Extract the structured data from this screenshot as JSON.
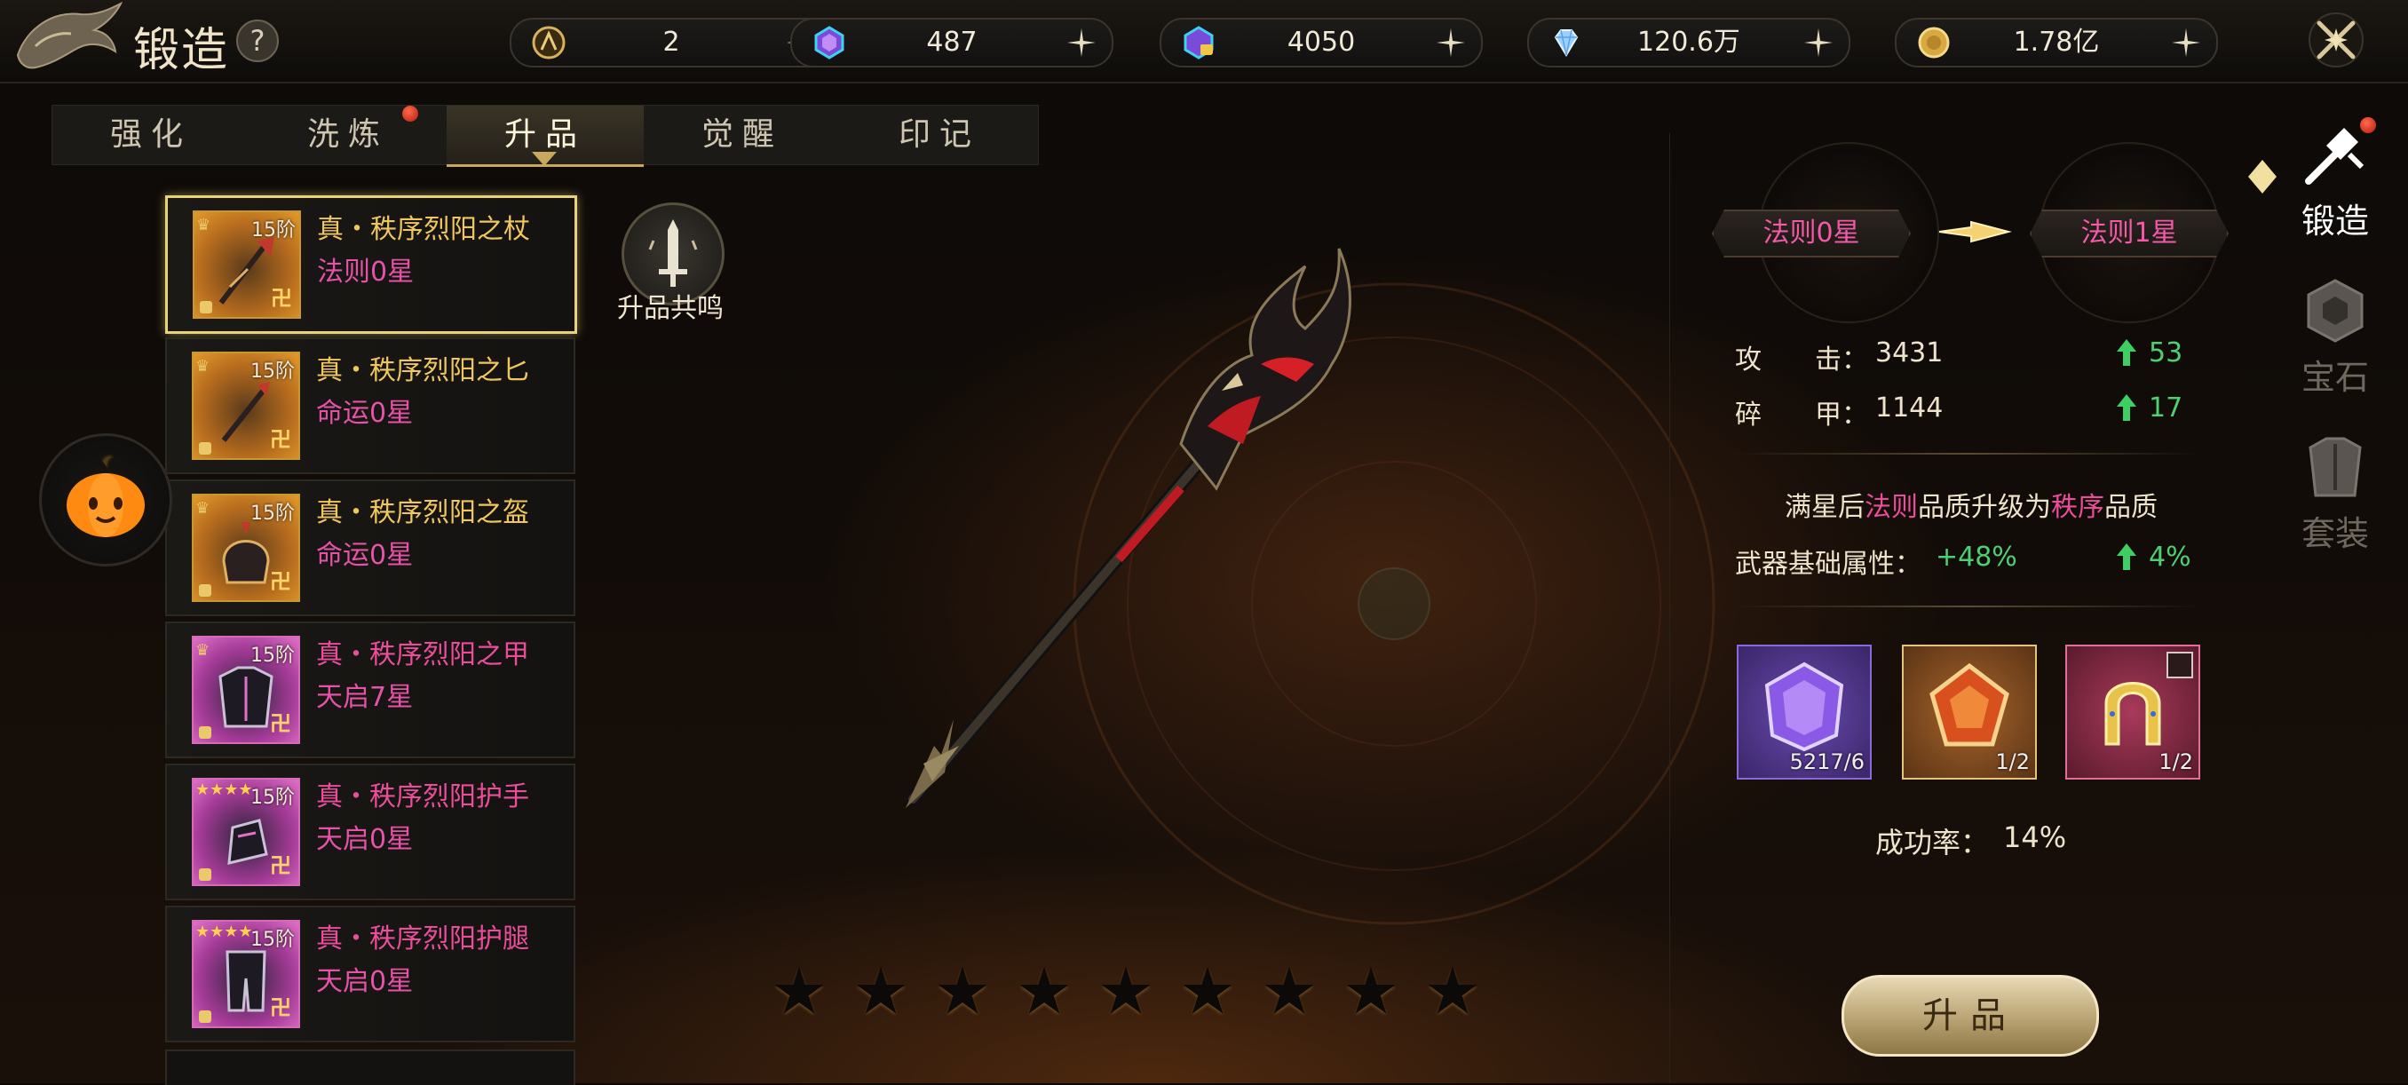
{
  "header": {
    "title": "锻造",
    "help_label": "?"
  },
  "resources": [
    {
      "icon": "compass-coin-icon",
      "value": "2"
    },
    {
      "icon": "purple-crystal-icon",
      "value": "487"
    },
    {
      "icon": "purple-crystal-lock-icon",
      "value": "4050"
    },
    {
      "icon": "diamond-icon",
      "value": "120.6万"
    },
    {
      "icon": "gold-coin-icon",
      "value": "1.78亿"
    }
  ],
  "tabs": [
    {
      "label": "强化",
      "active": false,
      "badge": false
    },
    {
      "label": "洗炼",
      "active": false,
      "badge": true
    },
    {
      "label": "升品",
      "active": true,
      "badge": false
    },
    {
      "label": "觉醒",
      "active": false,
      "badge": false
    },
    {
      "label": "印记",
      "active": false,
      "badge": false
    }
  ],
  "equipment": [
    {
      "name": "真・秩序烈阳之杖",
      "grade": "法则0星",
      "level": "15阶",
      "theme": "orange",
      "selected": true
    },
    {
      "name": "真・秩序烈阳之匕",
      "grade": "命运0星",
      "level": "15阶",
      "theme": "orange",
      "selected": false
    },
    {
      "name": "真・秩序烈阳之盔",
      "grade": "命运0星",
      "level": "15阶",
      "theme": "orange",
      "selected": false
    },
    {
      "name": "真・秩序烈阳之甲",
      "grade": "天启7星",
      "level": "15阶",
      "theme": "pink",
      "selected": false
    },
    {
      "name": "真・秩序烈阳护手",
      "grade": "天启0星",
      "level": "15阶",
      "theme": "pink",
      "selected": false
    },
    {
      "name": "真・秩序烈阳护腿",
      "grade": "天启0星",
      "level": "15阶",
      "theme": "pink",
      "selected": false
    }
  ],
  "resonance": {
    "label": "升品共鸣"
  },
  "stars": {
    "filled": 0,
    "total": 9
  },
  "upgrade": {
    "from_grade": "法则0星",
    "to_grade": "法则1星",
    "stats": [
      {
        "label": "攻　　击：",
        "value": "3431",
        "gain": "53"
      },
      {
        "label": "碎　　甲：",
        "value": "1144",
        "gain": "17"
      }
    ],
    "note_prefix": "满星后",
    "note_from": "法则",
    "note_mid": "品质升级为",
    "note_to": "秩序",
    "note_suffix": "品质",
    "base_attr_label": "武器基础属性：",
    "base_attr_value": "+48%",
    "base_attr_gain": "4%",
    "materials": [
      {
        "icon": "purple-gem-icon",
        "count": "5217/6"
      },
      {
        "icon": "red-gem-icon",
        "count": "1/2"
      },
      {
        "icon": "horseshoe-icon",
        "count": "1/2"
      }
    ],
    "success_rate_label": "成功率：",
    "success_rate": "14%",
    "button_label": "升品"
  },
  "side_nav": [
    {
      "label": "锻造",
      "active": true,
      "badge": true
    },
    {
      "label": "宝石",
      "active": false,
      "badge": false
    },
    {
      "label": "套装",
      "active": false,
      "badge": false
    }
  ],
  "colors": {
    "gold": "#f0c75e",
    "pink": "#ea4d9a",
    "green": "#4fd070",
    "button": "#b9a273"
  }
}
